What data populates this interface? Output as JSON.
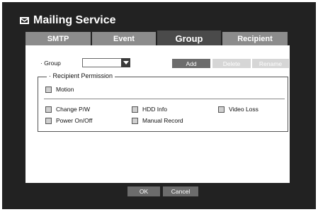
{
  "title": "Mailing Service",
  "tabs": [
    {
      "label": "SMTP"
    },
    {
      "label": "Event"
    },
    {
      "label": "Group"
    },
    {
      "label": "Recipient"
    }
  ],
  "group": {
    "label": "· Group",
    "selected": ""
  },
  "buttons": {
    "add": "Add",
    "delete": "Delete",
    "rename": "Rename",
    "ok": "OK",
    "cancel": "Cancel"
  },
  "permission": {
    "legend": "· Recipient Permission",
    "motion": "Motion",
    "items": [
      {
        "label": "Change P/W"
      },
      {
        "label": "HDD Info"
      },
      {
        "label": "Video Loss"
      },
      {
        "label": "Power On/Off"
      },
      {
        "label": "Manual Record"
      }
    ]
  },
  "colors": {
    "frame": "#222222",
    "tab_inactive": "#8c8c8c",
    "tab_active": "#4a4a4a",
    "button": "#6c6c6c",
    "button_disabled": "#d6d6d6"
  }
}
